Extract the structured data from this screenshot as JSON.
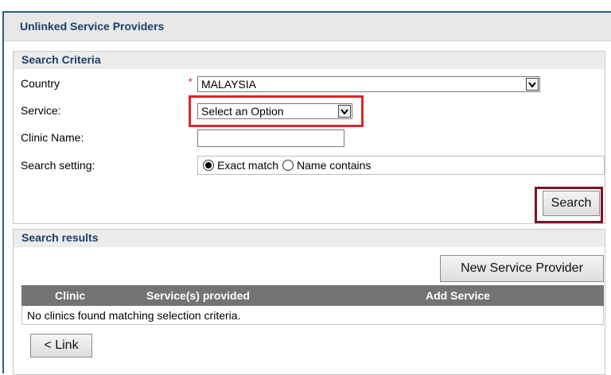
{
  "window": {
    "title": "Unlinked Service Providers"
  },
  "search_criteria": {
    "header": "Search Criteria",
    "country": {
      "label": "Country",
      "required_mark": "*",
      "value": "MALAYSIA"
    },
    "service": {
      "label": "Service:",
      "value": "Select an Option"
    },
    "clinic_name": {
      "label": "Clinic Name:",
      "value": ""
    },
    "search_setting": {
      "label": "Search setting:",
      "options": [
        "Exact match",
        "Name contains"
      ],
      "selected": "Exact match"
    },
    "search_button": "Search"
  },
  "search_results": {
    "header": "Search results",
    "new_button": "New Service Provider",
    "columns": [
      "Clinic",
      "Service(s) provided",
      "Add Service"
    ],
    "empty_message": "No clinics found matching selection criteria.",
    "link_button": "< Link"
  },
  "colors": {
    "title_text": "#1a3f6a",
    "frame_border": "#2f5b86",
    "highlight_red": "#d9262c",
    "highlight_maroon": "#7a1526",
    "table_header_bg": "#737373"
  },
  "icons": [
    "dropdown-arrow-icon",
    "radio-checked-icon",
    "radio-unchecked-icon"
  ]
}
